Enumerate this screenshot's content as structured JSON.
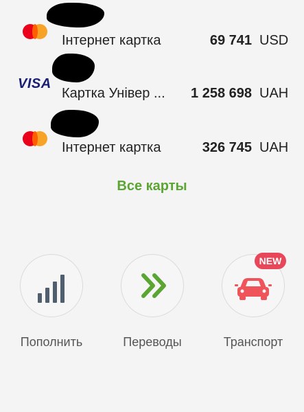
{
  "cards": [
    {
      "logo": "mastercard-logo",
      "name": "Інтернет картка",
      "amount": "69 741",
      "currency": "USD"
    },
    {
      "logo": "visa-logo",
      "logo_text": "VISA",
      "name": "Картка Універ ...",
      "amount": "1 258 698",
      "currency": "UAH"
    },
    {
      "logo": "mastercard-logo",
      "name": "Інтернет картка",
      "amount": "326 745",
      "currency": "UAH"
    }
  ],
  "all_cards_link": "Все карты",
  "actions": [
    {
      "icon": "signal-bars-icon",
      "label": "Пополнить"
    },
    {
      "icon": "double-chevron-right-icon",
      "label": "Переводы"
    },
    {
      "icon": "car-icon",
      "label": "Транспорт",
      "badge": "NEW"
    }
  ],
  "colors": {
    "accent_green": "#5ba533",
    "badge_red": "#e8475a",
    "car_red": "#f0545b",
    "bars_gray": "#4f5f6e"
  }
}
